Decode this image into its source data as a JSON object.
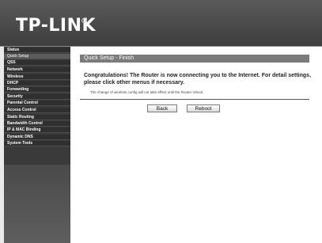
{
  "brand": {
    "logo_text": "TP-LINK"
  },
  "sidebar": {
    "items": [
      {
        "label": "Status",
        "active": false
      },
      {
        "label": "Quick Setup",
        "active": true
      },
      {
        "label": "QSS",
        "active": false
      },
      {
        "label": "Network",
        "active": false
      },
      {
        "label": "Wireless",
        "active": false
      },
      {
        "label": "DHCP",
        "active": false
      },
      {
        "label": "Forwarding",
        "active": false
      },
      {
        "label": "Security",
        "active": false
      },
      {
        "label": "Parental Control",
        "active": false
      },
      {
        "label": "Access Control",
        "active": false
      },
      {
        "label": "Static Routing",
        "active": false
      },
      {
        "label": "Bandwidth Control",
        "active": false
      },
      {
        "label": "IP & MAC Binding",
        "active": false
      },
      {
        "label": "Dynamic DNS",
        "active": false
      },
      {
        "label": "System Tools",
        "active": false
      }
    ]
  },
  "main": {
    "title": "Quick Setup - Finish",
    "message": "Congratulations! The Router is now connecting you to the Internet. For detail settings, please click other menus if necessary.",
    "note": "The change of wireless config will not take effect until the Router reboot.",
    "back_label": "Back",
    "reboot_label": "Reboot"
  }
}
